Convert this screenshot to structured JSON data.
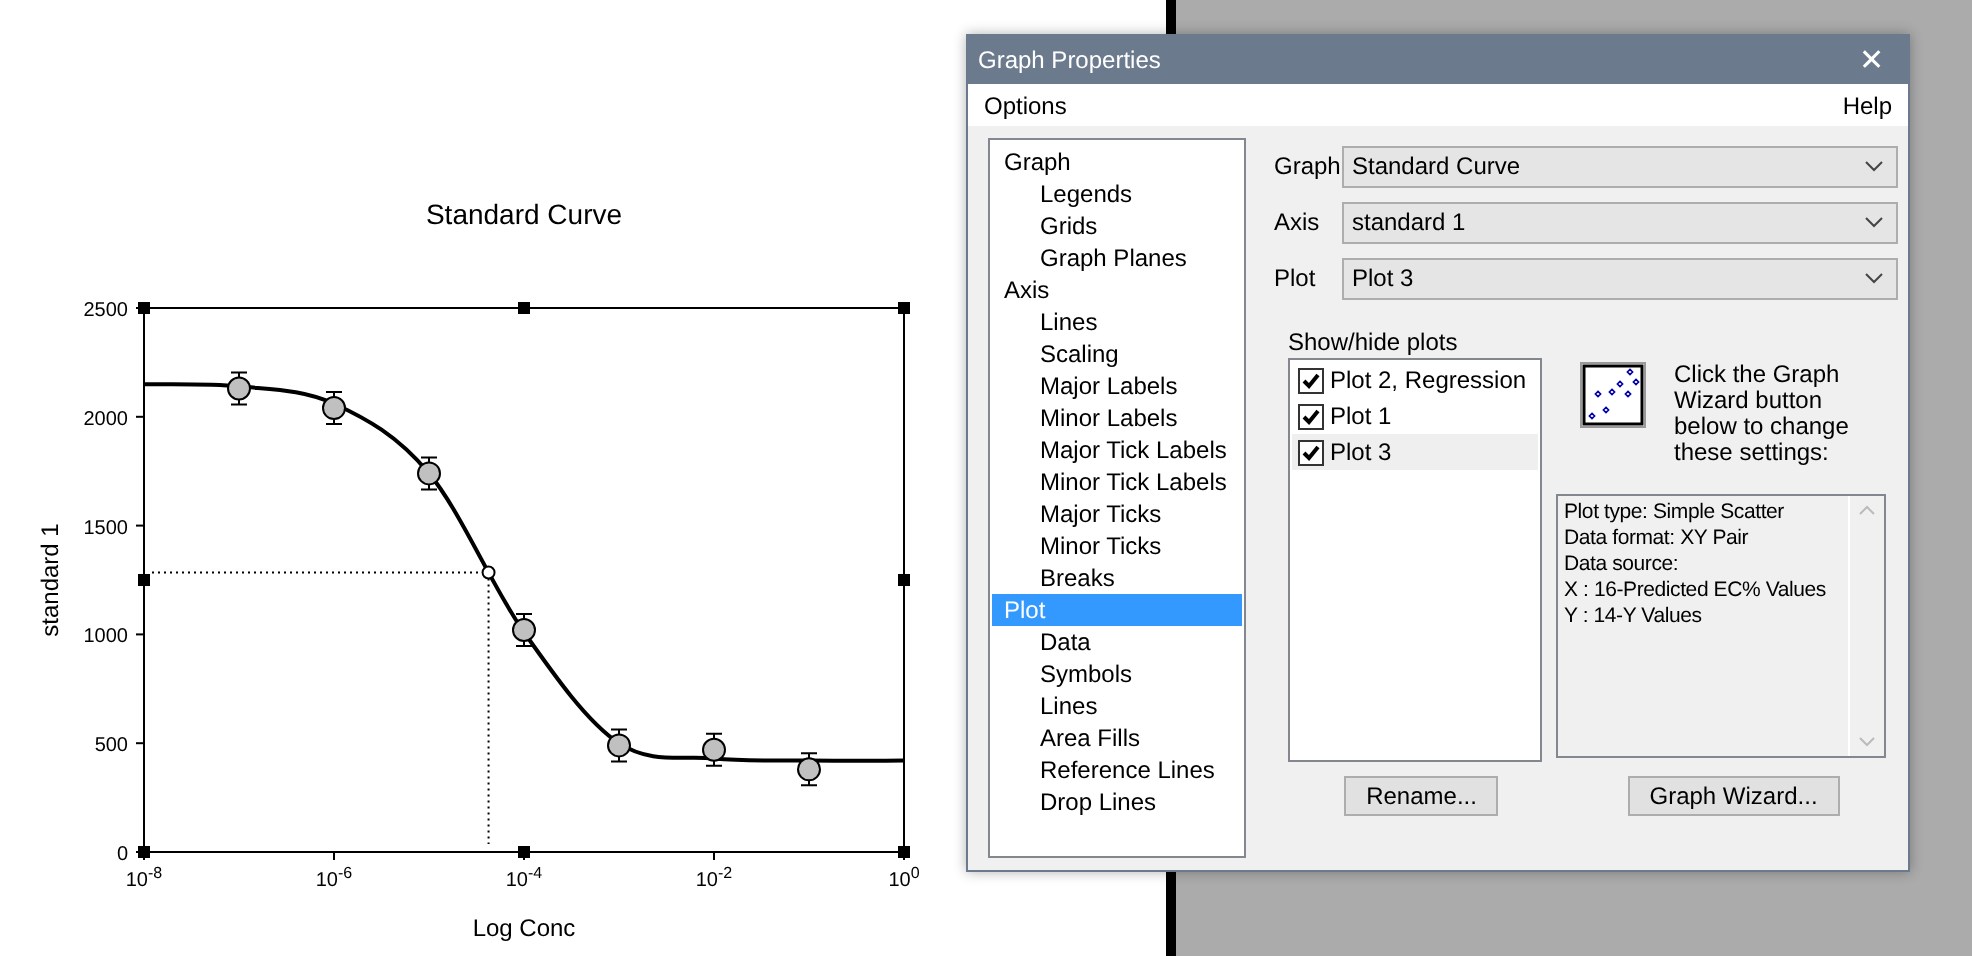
{
  "graph": {
    "chart_data": {
      "type": "line",
      "title": "Standard Curve",
      "xlabel": "Log Conc",
      "ylabel": "standard 1",
      "categories": [
        "10$^{-8}$",
        null,
        "10$^{-6}$",
        null,
        "10$^{-4}$",
        null,
        "10$^{-2}$",
        null,
        "10$^{0}$"
      ],
      "series": [
        {
          "color": "#000000",
          "values": [
            2150,
            2140,
            2060,
            1740,
            1010,
            500,
            430,
            420,
            420
          ]
        },
        {
          "type": "scatter",
          "color": "#c0c0c0",
          "values": [
            null,
            2130,
            2040,
            1740,
            1020,
            490,
            470,
            380,
            null
          ]
        }
      ],
      "ylim": [
        0,
        2500
      ],
      "yticks": [
        0,
        500,
        1000,
        1500,
        2000,
        2500
      ]
    },
    "selected": true
  },
  "dialog": {
    "title": "Graph Properties",
    "close": "✕",
    "menu": [
      "Options",
      "Help"
    ],
    "tree": [
      {
        "label": "Graph",
        "selected": false,
        "children": [
          {
            "label": "Legends",
            "selected": false
          },
          {
            "label": "Grids",
            "selected": false
          },
          {
            "label": "Graph Planes",
            "selected": false
          }
        ]
      },
      {
        "label": "Axis",
        "selected": false,
        "children": [
          {
            "label": "Lines",
            "selected": false
          },
          {
            "label": "Scaling",
            "selected": false
          },
          {
            "label": "Major Labels",
            "selected": false
          },
          {
            "label": "Minor Labels",
            "selected": false
          },
          {
            "label": "Major Tick Labels",
            "selected": false
          },
          {
            "label": "Minor Tick Labels",
            "selected": false
          },
          {
            "label": "Major Ticks",
            "selected": false
          },
          {
            "label": "Minor Ticks",
            "selected": false
          },
          {
            "label": "Breaks",
            "selected": false
          }
        ]
      },
      {
        "label": "Plot",
        "selected": true,
        "children": [
          {
            "label": "Data",
            "selected": false
          },
          {
            "label": "Symbols",
            "selected": false
          },
          {
            "label": "Lines",
            "selected": false
          },
          {
            "label": "Area Fills",
            "selected": false
          },
          {
            "label": "Reference Lines",
            "selected": false
          },
          {
            "label": "Drop Lines",
            "selected": false
          }
        ]
      }
    ],
    "selectors": [
      {
        "label": "Graph",
        "value": "Standard Curve"
      },
      {
        "label": "Axis",
        "value": "standard 1"
      },
      {
        "label": "Plot",
        "value": "Plot 3"
      }
    ],
    "plots_label": "Show/hide plots",
    "plots": [
      {
        "label": "Plot 2, Regression",
        "checked": true,
        "selected": false
      },
      {
        "label": "Plot 1",
        "checked": true,
        "selected": false
      },
      {
        "label": "Plot 3",
        "checked": true,
        "selected": true
      }
    ],
    "wizard_hint": "Click the Graph Wizard button below to change these settings:",
    "info_lines": [
      "Plot type: Simple Scatter",
      "Data format: XY Pair",
      "Data source:",
      "X : 16-Predicted EC% Values",
      "Y : 14-Y Values"
    ],
    "buttons": [
      "Rename...",
      "Graph Wizard..."
    ]
  }
}
